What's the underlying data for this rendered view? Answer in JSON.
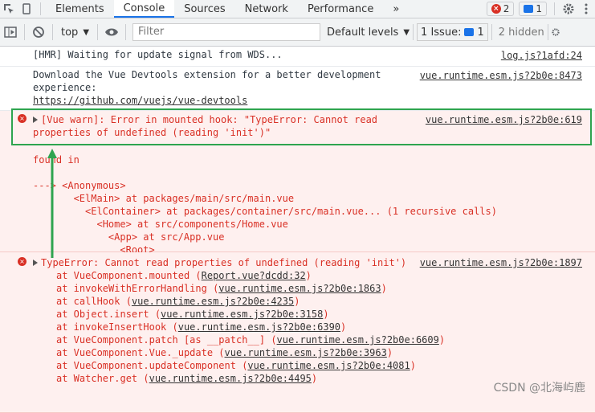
{
  "tabs": [
    "Elements",
    "Console",
    "Sources",
    "Network",
    "Performance"
  ],
  "more_tabs": "»",
  "error_count": "2",
  "message_count": "1",
  "toolbar": {
    "context": "top",
    "filter_placeholder": "Filter",
    "levels": "Default levels",
    "issues_label": "1 Issue:",
    "issues_count": "1",
    "hidden": "2 hidden"
  },
  "messages": [
    {
      "text": "[HMR] Waiting for update signal from WDS...",
      "source": "log.js?1afd:24"
    },
    {
      "text": "Download the Vue Devtools extension for a better development experience:",
      "link": "https://github.com/vuejs/vue-devtools",
      "source": "vue.runtime.esm.js?2b0e:8473"
    }
  ],
  "error1": {
    "text": "[Vue warn]: Error in mounted hook: \"TypeError: Cannot read properties of undefined (reading 'init')\"",
    "source": "vue.runtime.esm.js?2b0e:619",
    "found_in": "found in",
    "trace": [
      "---> <Anonymous>",
      "       <ElMain> at packages/main/src/main.vue",
      "         <ElContainer> at packages/container/src/main.vue... (1 recursive calls)",
      "           <Home> at src/components/Home.vue",
      "             <App> at src/App.vue",
      "               <Root>"
    ]
  },
  "error2": {
    "text": "TypeError: Cannot read properties of undefined (reading 'init')",
    "source": "vue.runtime.esm.js?2b0e:1897",
    "stack": [
      {
        "fn": "at VueComponent.mounted",
        "loc": "Report.vue?dcdd:32"
      },
      {
        "fn": "at invokeWithErrorHandling",
        "loc": "vue.runtime.esm.js?2b0e:1863"
      },
      {
        "fn": "at callHook",
        "loc": "vue.runtime.esm.js?2b0e:4235"
      },
      {
        "fn": "at Object.insert",
        "loc": "vue.runtime.esm.js?2b0e:3158"
      },
      {
        "fn": "at invokeInsertHook",
        "loc": "vue.runtime.esm.js?2b0e:6390"
      },
      {
        "fn": "at VueComponent.patch [as __patch__]",
        "loc": "vue.runtime.esm.js?2b0e:6609"
      },
      {
        "fn": "at VueComponent.Vue._update",
        "loc": "vue.runtime.esm.js?2b0e:3963"
      },
      {
        "fn": "at VueComponent.updateComponent",
        "loc": "vue.runtime.esm.js?2b0e:4081"
      },
      {
        "fn": "at Watcher.get",
        "loc": "vue.runtime.esm.js?2b0e:4495"
      }
    ]
  },
  "watermark": "CSDN @北海屿鹿",
  "colors": {
    "error": "#d93025",
    "highlight": "#2ea44f",
    "accent": "#1a73e8"
  }
}
